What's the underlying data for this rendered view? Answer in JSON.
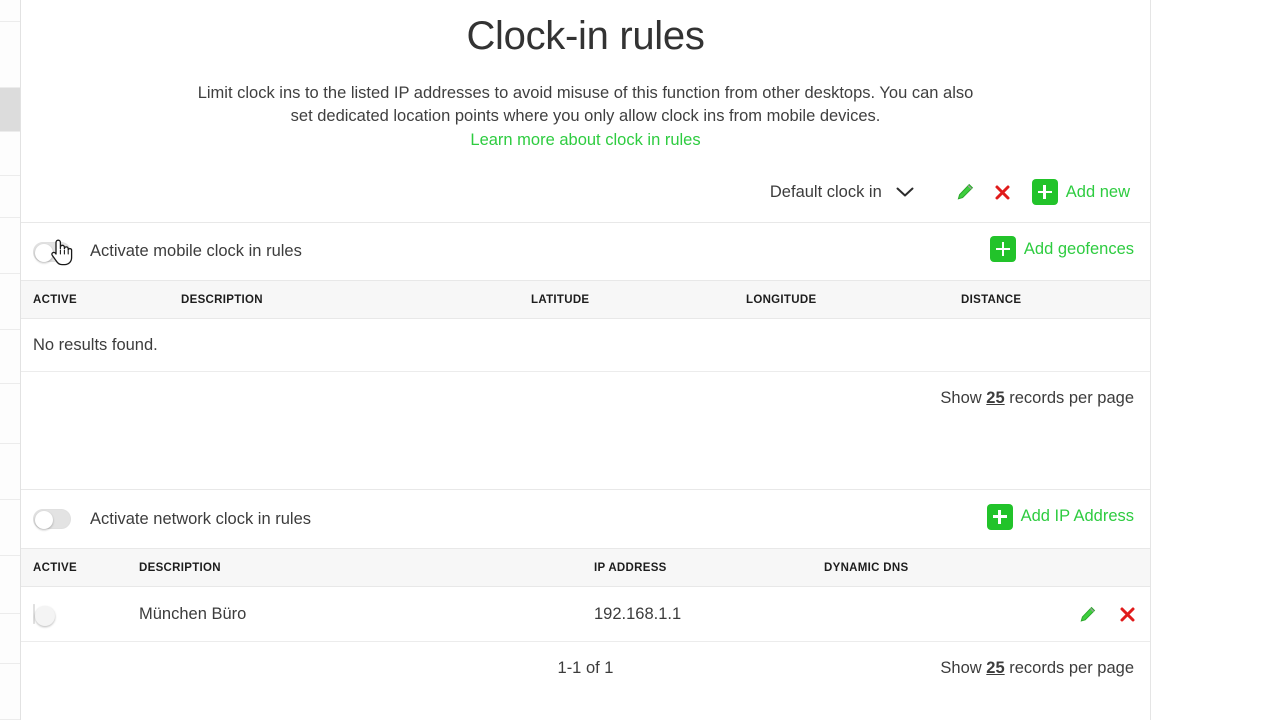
{
  "page": {
    "title": "Clock-in rules",
    "intro_line1": "Limit clock ins to the listed IP addresses to avoid misuse of this function from other desktops. You can also",
    "intro_line2": "set dedicated location points where you only allow clock ins from mobile devices.",
    "learn_more": "Learn more about clock in rules"
  },
  "toolbar": {
    "profile_selected": "Default clock in",
    "chevron_icon": "chevron-down-icon",
    "edit_icon": "pencil-icon",
    "delete_icon": "red-x-icon",
    "add_new_label": "Add new",
    "add_icon": "plus-icon"
  },
  "mobile_section": {
    "toggle_label": "Activate mobile clock in rules",
    "toggle_state": "off",
    "add_button_label": "Add geofences",
    "add_icon": "plus-icon",
    "columns": [
      "ACTIVE",
      "DESCRIPTION",
      "LATITUDE",
      "LONGITUDE",
      "DISTANCE"
    ],
    "empty_message": "No results found.",
    "pager": {
      "show_prefix": "Show",
      "records_value": "25",
      "show_suffix": "records per page"
    }
  },
  "network_section": {
    "toggle_label": "Activate network clock in rules",
    "toggle_state": "off",
    "add_button_label": "Add IP Address",
    "add_icon": "plus-icon",
    "columns": [
      "ACTIVE",
      "DESCRIPTION",
      "IP ADDRESS",
      "DYNAMIC DNS"
    ],
    "rows": [
      {
        "active": "off",
        "description": "München Büro",
        "ip_address": "192.168.1.1",
        "dynamic_dns": "",
        "edit_icon": "pencil-icon",
        "delete_icon": "red-x-icon"
      }
    ],
    "pager": {
      "range": "1-1 of 1",
      "show_prefix": "Show",
      "records_value": "25",
      "show_suffix": "records per page"
    }
  },
  "colors": {
    "green": "#22c32a",
    "green_text": "#2ecc40",
    "red": "#e01b1b",
    "header_bg": "#f7f7f7"
  },
  "cursor": {
    "icon": "pointing-hand-cursor"
  }
}
